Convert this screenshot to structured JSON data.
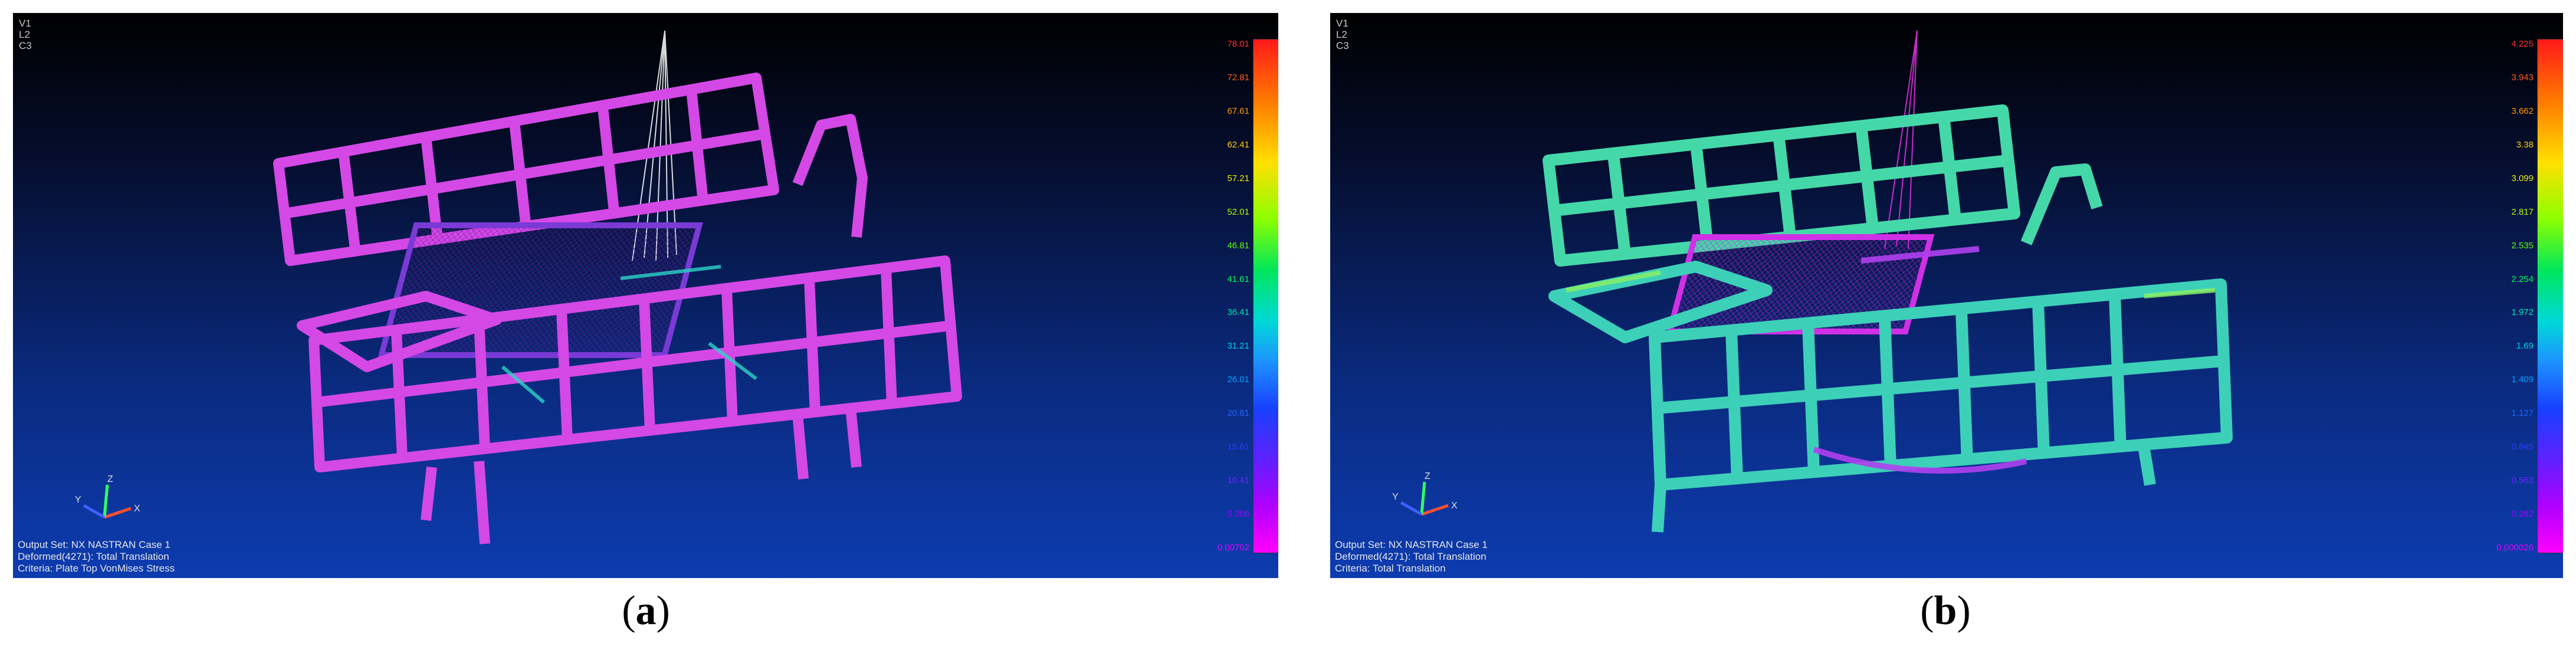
{
  "panel_a": {
    "header": [
      "V1",
      "L2",
      "C3"
    ],
    "legend": [
      "78.01",
      "72.81",
      "67.61",
      "62.41",
      "57.21",
      "52.01",
      "46.81",
      "41.61",
      "36.41",
      "31.21",
      "26.01",
      "20.81",
      "15.61",
      "10.41",
      "5.206",
      "0.00702"
    ],
    "legend_colors": [
      "#ff3030",
      "#ff5a1e",
      "#ff9a00",
      "#ffd000",
      "#e6f000",
      "#a8ff00",
      "#5cff00",
      "#00ff50",
      "#00e6b4",
      "#00d2e6",
      "#00a0ff",
      "#1e64ff",
      "#2a3cff",
      "#6a28ff",
      "#a000ff",
      "#e000ff"
    ],
    "footer": [
      "Output Set: NX NASTRAN Case 1",
      "Deformed(4271): Total Translation",
      "Criteria: Plate Top VonMises Stress"
    ],
    "caption_label": "a",
    "frame_color": "#d040e0",
    "mesh_color": "#9a30d8"
  },
  "panel_b": {
    "header": [
      "V1",
      "L2",
      "C3"
    ],
    "legend": [
      "4.225",
      "3.943",
      "3.662",
      "3.38",
      "3.099",
      "2.817",
      "2.535",
      "2.254",
      "1.972",
      "1.69",
      "1.409",
      "1.127",
      "0.845",
      "0.563",
      "0.282",
      "0.000026"
    ],
    "legend_colors": [
      "#ff3030",
      "#ff5a1e",
      "#ff9a00",
      "#ffd000",
      "#e6f000",
      "#a8ff00",
      "#5cff00",
      "#00ff50",
      "#00e6b4",
      "#00d2e6",
      "#00a0ff",
      "#1e64ff",
      "#2a3cff",
      "#6a28ff",
      "#a000ff",
      "#e000ff"
    ],
    "footer": [
      "Output Set: NX NASTRAN Case 1",
      "Deformed(4271): Total Translation",
      "Criteria: Total Translation"
    ],
    "caption_label": "b",
    "frame_color": "#3ed6a0",
    "mesh_color": "#7a40e0"
  }
}
